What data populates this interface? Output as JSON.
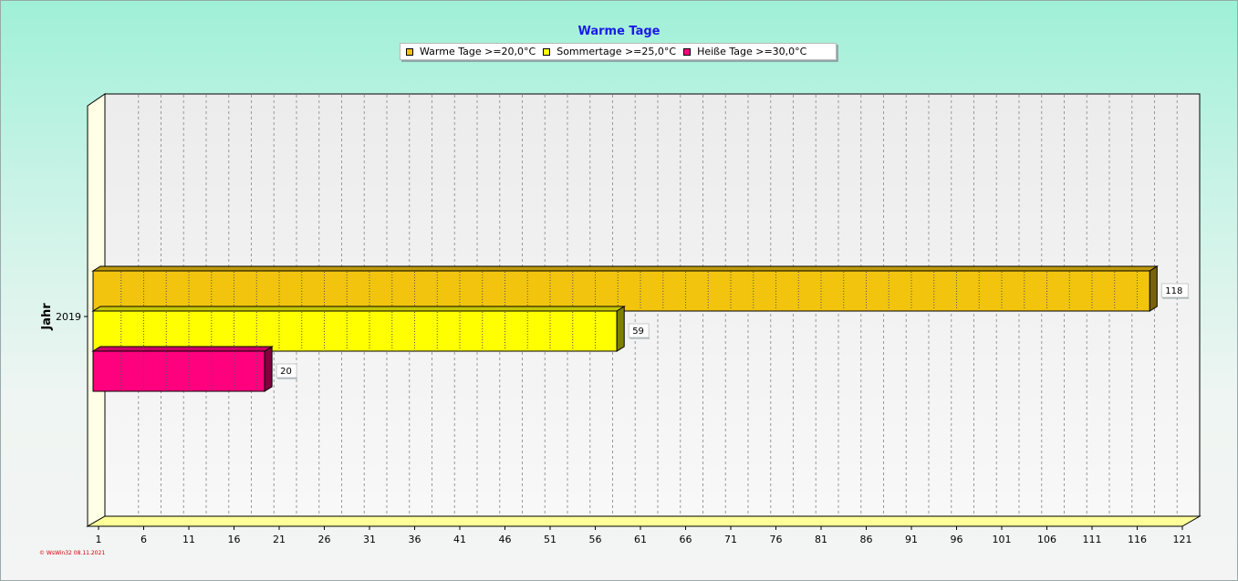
{
  "chart_data": {
    "type": "bar",
    "orientation": "horizontal",
    "title": "Warme Tage",
    "ylabel": "Jahr",
    "xlabel": "",
    "categories": [
      "2019"
    ],
    "series": [
      {
        "name": "Warme Tage >=20,0°C",
        "values": [
          118
        ],
        "color": "#f2c40e",
        "labels": [
          "118"
        ]
      },
      {
        "name": "Sommertage >=25,0°C",
        "values": [
          59
        ],
        "color": "#ffff00",
        "labels": [
          "59"
        ]
      },
      {
        "name": "Heiße Tage >=30,0°C",
        "values": [
          20
        ],
        "color": "#ff007f",
        "labels": [
          "20"
        ]
      }
    ],
    "xlim": [
      1,
      121
    ],
    "xticks": [
      1,
      6,
      11,
      16,
      21,
      26,
      31,
      36,
      41,
      46,
      51,
      56,
      61,
      66,
      71,
      76,
      81,
      86,
      91,
      96,
      101,
      106,
      111,
      116,
      121
    ],
    "grid": true,
    "legend_position": "top-center"
  },
  "footer": {
    "text": "© WsWin32  08.11.2021"
  },
  "colors": {
    "title": "#1a1ae6",
    "footer": "#cc0000",
    "floor": "#ffff99",
    "wall": "#ffffe6"
  }
}
